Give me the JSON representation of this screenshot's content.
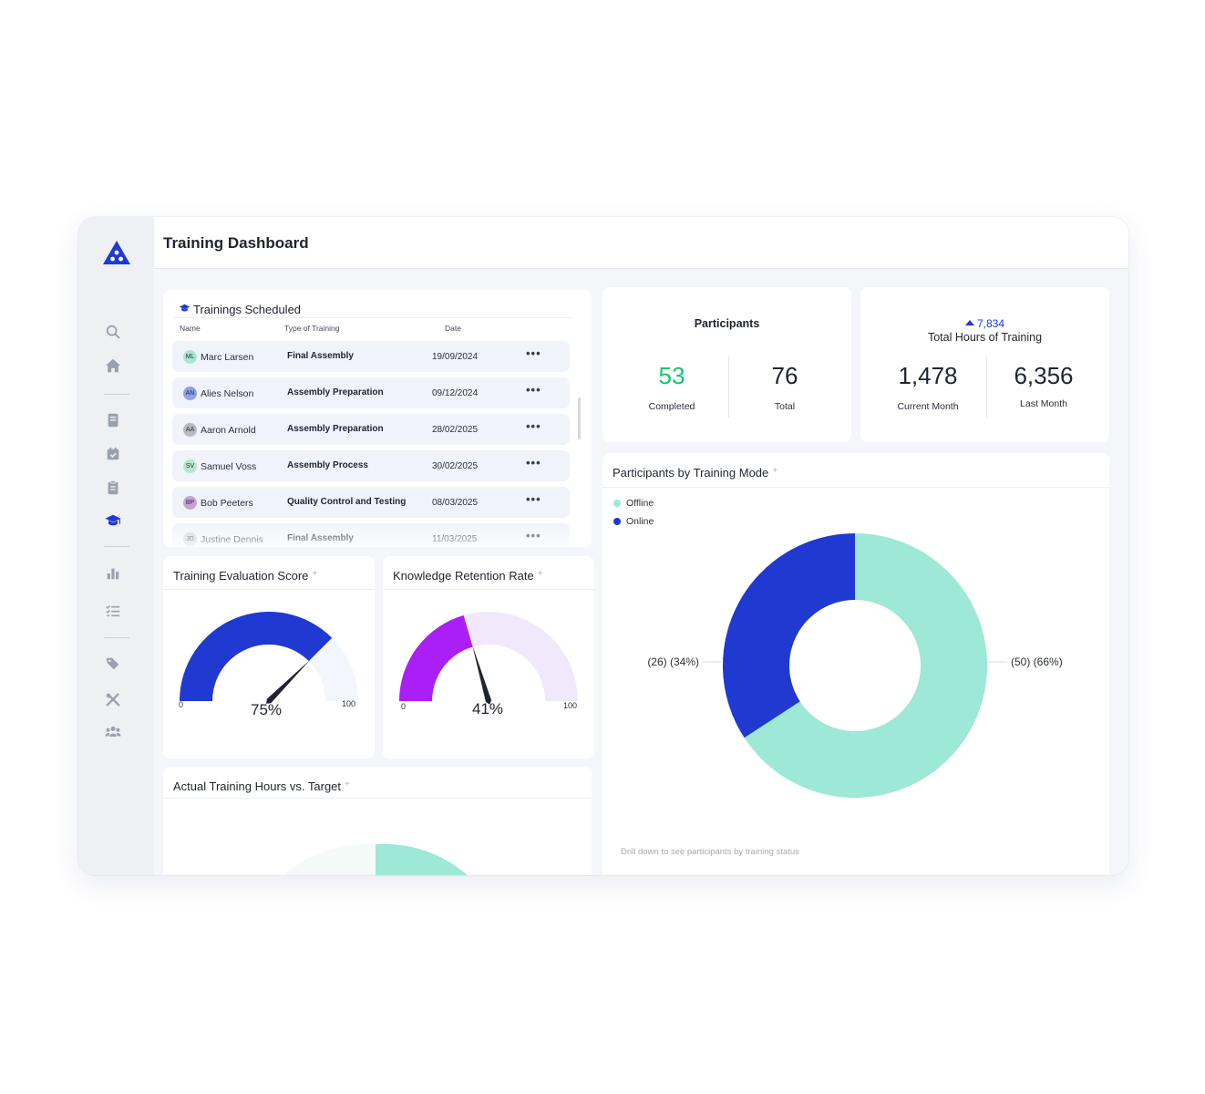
{
  "app": {
    "title": "Training Dashboard"
  },
  "sidebar": {
    "logo": "app-logo",
    "items": [
      {
        "icon": "search-icon"
      },
      {
        "icon": "home-icon"
      },
      {
        "icon": "book-icon"
      },
      {
        "icon": "calendar-icon"
      },
      {
        "icon": "clipboard-icon"
      },
      {
        "icon": "graduation-cap-icon",
        "active": true
      },
      {
        "icon": "bar-chart-icon"
      },
      {
        "icon": "checklist-icon"
      },
      {
        "icon": "tags-icon"
      },
      {
        "icon": "tools-icon"
      },
      {
        "icon": "users-icon"
      }
    ]
  },
  "colors": {
    "accent": "#1f39d1",
    "teal": "#9de8d7",
    "purple": "#a91ff5",
    "green": "#18c472",
    "gauge_bg_blue": "#f3f6fc",
    "gauge_bg_purple": "#f1e9fb"
  },
  "trainings": {
    "title": "Trainings Scheduled",
    "columns": [
      "Name",
      "Type of Training",
      "Date"
    ],
    "rows": [
      {
        "initials": "ML",
        "avatar_color": "#a8e6d4",
        "name": "Marc Larsen",
        "type": "Final Assembly",
        "date": "19/09/2024",
        "more": "•••"
      },
      {
        "initials": "AN",
        "avatar_color": "#8fa0ec",
        "name": "Alies Nelson",
        "type": "Assembly Preparation",
        "date": "09/12/2024",
        "more": "•••"
      },
      {
        "initials": "AA",
        "avatar_color": "#b9b9bf",
        "name": "Aaron Arnold",
        "type": "Assembly Preparation",
        "date": "28/02/2025",
        "more": "•••"
      },
      {
        "initials": "SV",
        "avatar_color": "#b7e5cf",
        "name": "Samuel Voss",
        "type": "Assembly Process",
        "date": "30/02/2025",
        "more": "•••"
      },
      {
        "initials": "BP",
        "avatar_color": "#c9a3d8",
        "name": "Bob Peeters",
        "type": "Quality Control and Testing",
        "date": "08/03/2025",
        "more": "•••"
      },
      {
        "initials": "JD",
        "avatar_color": "#cfd2d8",
        "name": "Justine Dennis",
        "type": "Final Assembly",
        "date": "11/03/2025",
        "more": "•••"
      }
    ]
  },
  "participants": {
    "title": "Participants",
    "completed": {
      "value": "53",
      "label": "Completed"
    },
    "total": {
      "value": "76",
      "label": "Total"
    }
  },
  "hours": {
    "trend_value": "7,834",
    "title": "Total Hours of Training",
    "current": {
      "value": "1,478",
      "label": "Current Month"
    },
    "last": {
      "value": "6,356",
      "label": "Last Month"
    }
  },
  "evaluation": {
    "title": "Training Evaluation Score",
    "plus": "+",
    "value": 75,
    "display": "75%",
    "min": "0",
    "max": "100"
  },
  "retention": {
    "title": "Knowledge Retention Rate",
    "plus": "+",
    "value": 41,
    "display": "41%",
    "min": "0",
    "max": "100"
  },
  "actual_hours": {
    "title": "Actual Training Hours vs. Target",
    "plus": "+"
  },
  "chart_data": {
    "type": "pie",
    "title": "Participants by Training Mode",
    "series": [
      {
        "name": "Offline",
        "value": 50,
        "percent": 66,
        "color": "#9de8d7",
        "label": "(50) (66%)"
      },
      {
        "name": "Online",
        "value": 26,
        "percent": 34,
        "color": "#1f39d1",
        "label": "(26) (34%)"
      }
    ],
    "legend": "top-left",
    "donut": true,
    "footnote": "Drill down to see participants by training status"
  },
  "mode_card": {
    "plus": "+"
  }
}
